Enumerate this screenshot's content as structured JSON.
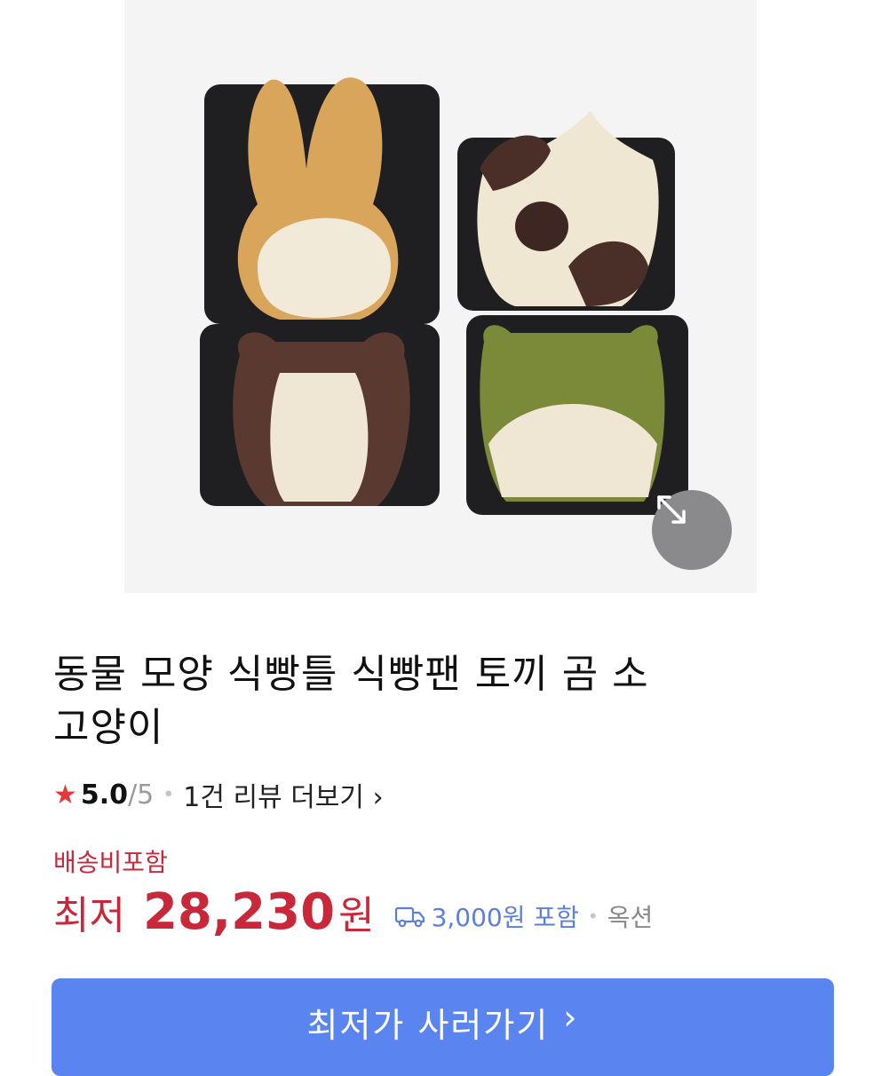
{
  "product": {
    "image_alt": "animal-shaped bread loaves in black pans",
    "title_line1": "동물 모양 식빵틀 식빵팬 토끼 곰 소",
    "title_line2": "고양이"
  },
  "rating": {
    "star": "★",
    "score": "5.0",
    "max": "/5",
    "review_link": "1건 리뷰 더보기",
    "review_chevron": "›"
  },
  "price": {
    "shipping_tag": "배송비포함",
    "prefix": "최저",
    "value": "28,230",
    "unit": "원",
    "shipping_fee": "3,000원 포함",
    "source": "옥션"
  },
  "cta": {
    "label": "최저가 사러가기",
    "chevron": "›"
  },
  "colors": {
    "accent_red": "#c8283a",
    "cta_blue": "#5a85f0",
    "link_blue": "#5b7fde"
  }
}
